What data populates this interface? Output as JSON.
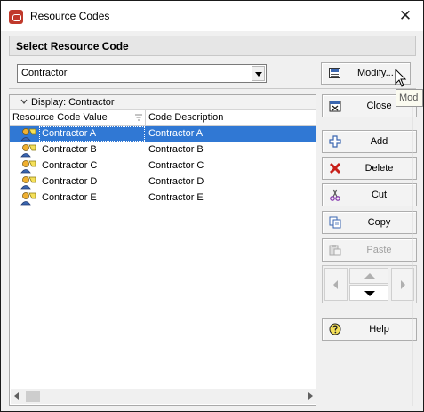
{
  "window": {
    "title": "Resource Codes",
    "close_glyph": "✕"
  },
  "section": {
    "title": "Select Resource Code"
  },
  "selector": {
    "value": "Contractor",
    "modify_label": "Modify...",
    "modify_icon": "modify-form-icon",
    "tooltip": "Mod"
  },
  "grid": {
    "group_label": "Display: Contractor",
    "columns": [
      "Resource Code Value",
      "Code Description"
    ],
    "rows": [
      {
        "value": "Contractor A",
        "description": "Contractor A",
        "selected": true
      },
      {
        "value": "Contractor B",
        "description": "Contractor B",
        "selected": false
      },
      {
        "value": "Contractor C",
        "description": "Contractor C",
        "selected": false
      },
      {
        "value": "Contractor D",
        "description": "Contractor D",
        "selected": false
      },
      {
        "value": "Contractor E",
        "description": "Contractor E",
        "selected": false
      }
    ]
  },
  "actions": [
    {
      "label": "Close",
      "icon": "close-window-icon",
      "enabled": true
    },
    {
      "label": "Add",
      "icon": "plus-icon",
      "enabled": true
    },
    {
      "label": "Delete",
      "icon": "delete-x-icon",
      "enabled": true
    },
    {
      "label": "Cut",
      "icon": "scissors-icon",
      "enabled": true
    },
    {
      "label": "Copy",
      "icon": "copy-icon",
      "enabled": true
    },
    {
      "label": "Paste",
      "icon": "paste-icon",
      "enabled": false
    },
    {
      "label": "Help",
      "icon": "help-icon",
      "enabled": true
    }
  ],
  "colors": {
    "selection": "#3078d4",
    "delete_red": "#c8201a",
    "accent_blue": "#3a66b0"
  }
}
